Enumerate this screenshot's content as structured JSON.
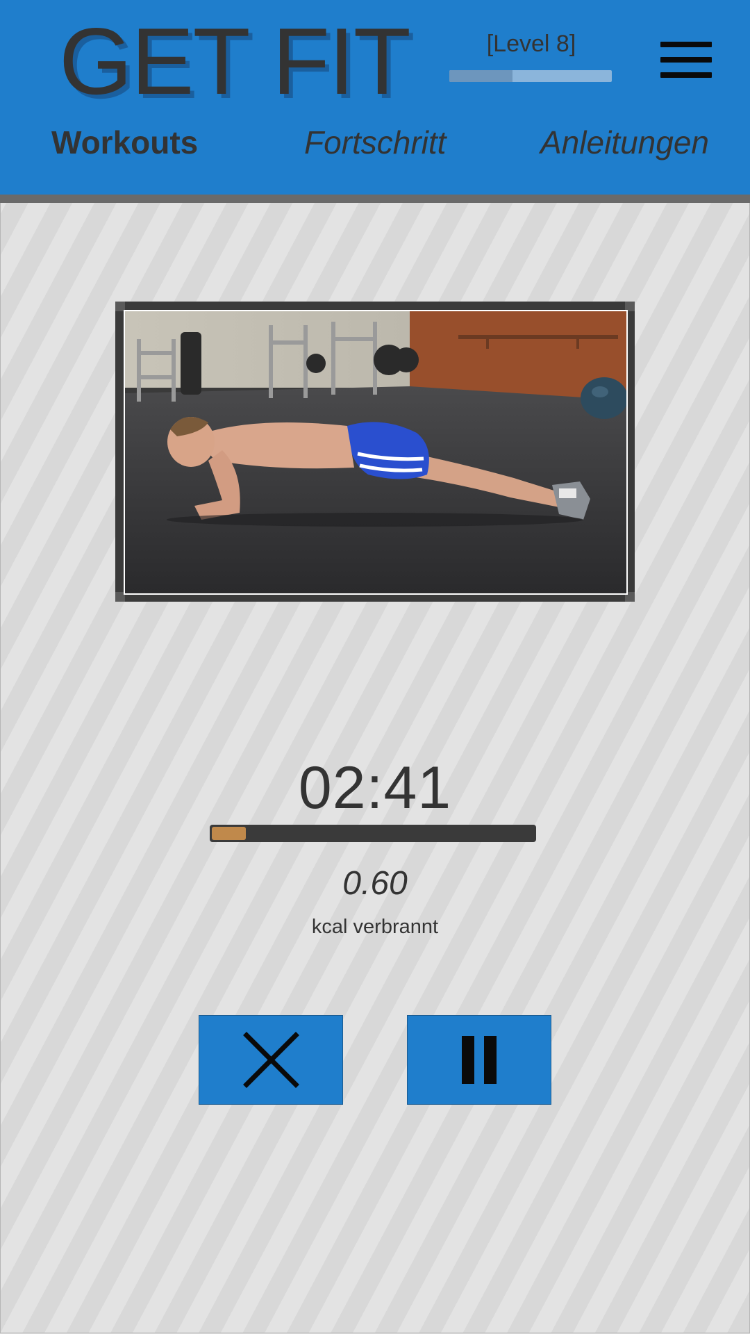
{
  "app": {
    "title": "GET FIT",
    "level_label": "[Level 8]",
    "level_progress": 0.39
  },
  "nav": {
    "tabs": [
      {
        "label": "Workouts",
        "active": true
      },
      {
        "label": "Fortschritt",
        "active": false
      },
      {
        "label": "Anleitungen",
        "active": false
      }
    ]
  },
  "workout": {
    "timer": "02:41",
    "progress": 0.11,
    "kcal_value": "0.60",
    "kcal_label": "kcal verbrannt"
  },
  "controls": {
    "stop_icon": "close-icon",
    "pause_icon": "pause-icon"
  },
  "colors": {
    "header": "#1f7ecc",
    "progress_fill": "#c0894b",
    "progress_track": "#3a3a3a",
    "text": "#333333"
  }
}
